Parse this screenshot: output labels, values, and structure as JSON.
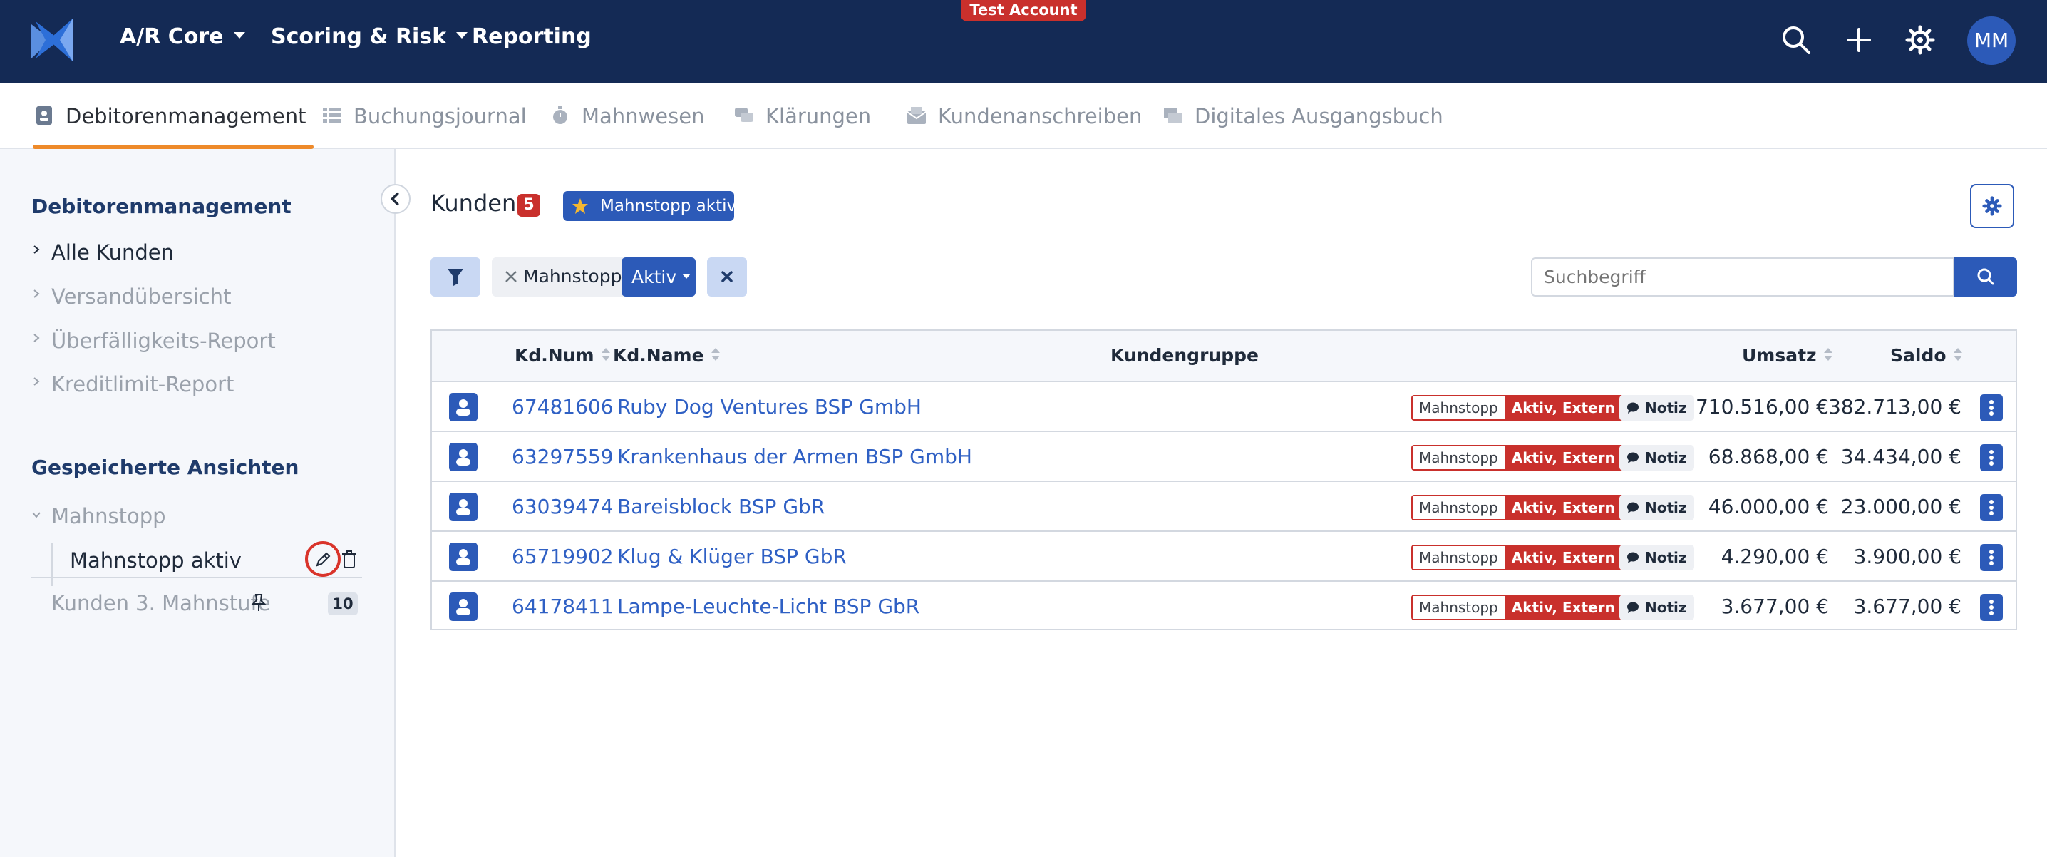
{
  "topbar": {
    "nav": [
      {
        "label": "A/R Core",
        "has_dropdown": true
      },
      {
        "label": "Scoring & Risk",
        "has_dropdown": true
      },
      {
        "label": "Reporting",
        "has_dropdown": false
      }
    ],
    "test_badge": "Test Account",
    "icons": [
      "search-icon",
      "plus-icon",
      "gear-icon"
    ],
    "avatar_initials": "MM",
    "colors": {
      "background": "#142a55",
      "accent": "#2c5ab8",
      "test_badge": "#c9302c"
    }
  },
  "tabs": [
    {
      "label": "Debitorenmanagement",
      "icon": "contact-card-icon",
      "active": true
    },
    {
      "label": "Buchungsjournal",
      "icon": "list-icon",
      "active": false
    },
    {
      "label": "Mahnwesen",
      "icon": "stopwatch-icon",
      "active": false
    },
    {
      "label": "Klärungen",
      "icon": "chat-icon",
      "active": false
    },
    {
      "label": "Kundenanschreiben",
      "icon": "envelope-icon",
      "active": false
    },
    {
      "label": "Digitales Ausgangsbuch",
      "icon": "folder-icon",
      "active": false
    }
  ],
  "sidebar": {
    "section_title": "Debitorenmanagement",
    "links": [
      {
        "label": "Alle Kunden",
        "active": true
      },
      {
        "label": "Versandübersicht",
        "active": false
      },
      {
        "label": "Überfälligkeits-Report",
        "active": false
      },
      {
        "label": "Kreditlimit-Report",
        "active": false
      }
    ],
    "saved_views_title": "Gespeicherte Ansichten",
    "group_label": "Mahnstopp",
    "group_item": "Mahnstopp aktiv",
    "other_view": {
      "label": "Kunden 3. Mahnstufe",
      "count": "10"
    }
  },
  "main": {
    "title": "Kunden",
    "count": "5",
    "active_view": "Mahnstopp aktiv",
    "filter": {
      "label": "Mahnstopp",
      "value": "Aktiv"
    },
    "search_placeholder": "Suchbegriff",
    "columns": {
      "num": "Kd.Num",
      "name": "Kd.Name",
      "group": "Kundengruppe",
      "umsatz": "Umsatz",
      "saldo": "Saldo"
    },
    "rows": [
      {
        "num": "67481606",
        "name": "Ruby Dog Ventures BSP GmbH",
        "tag_label": "Mahnstopp",
        "tag_status": "Aktiv, Extern",
        "note": "Notiz",
        "umsatz": "710.516,00 €",
        "saldo": "382.713,00 €"
      },
      {
        "num": "63297559",
        "name": "Krankenhaus der Armen BSP GmbH",
        "tag_label": "Mahnstopp",
        "tag_status": "Aktiv, Extern",
        "note": "Notiz",
        "umsatz": "68.868,00 €",
        "saldo": "34.434,00 €"
      },
      {
        "num": "63039474",
        "name": "Bareisblock BSP GbR",
        "tag_label": "Mahnstopp",
        "tag_status": "Aktiv, Extern",
        "note": "Notiz",
        "umsatz": "46.000,00 €",
        "saldo": "23.000,00 €"
      },
      {
        "num": "65719902",
        "name": "Klug & Klüger BSP GbR",
        "tag_label": "Mahnstopp",
        "tag_status": "Aktiv, Extern",
        "note": "Notiz",
        "umsatz": "4.290,00 €",
        "saldo": "3.900,00 €"
      },
      {
        "num": "64178411",
        "name": "Lampe-Leuchte-Licht BSP GbR",
        "tag_label": "Mahnstopp",
        "tag_status": "Aktiv, Extern",
        "note": "Notiz",
        "umsatz": "3.677,00 €",
        "saldo": "3.677,00 €"
      }
    ]
  }
}
